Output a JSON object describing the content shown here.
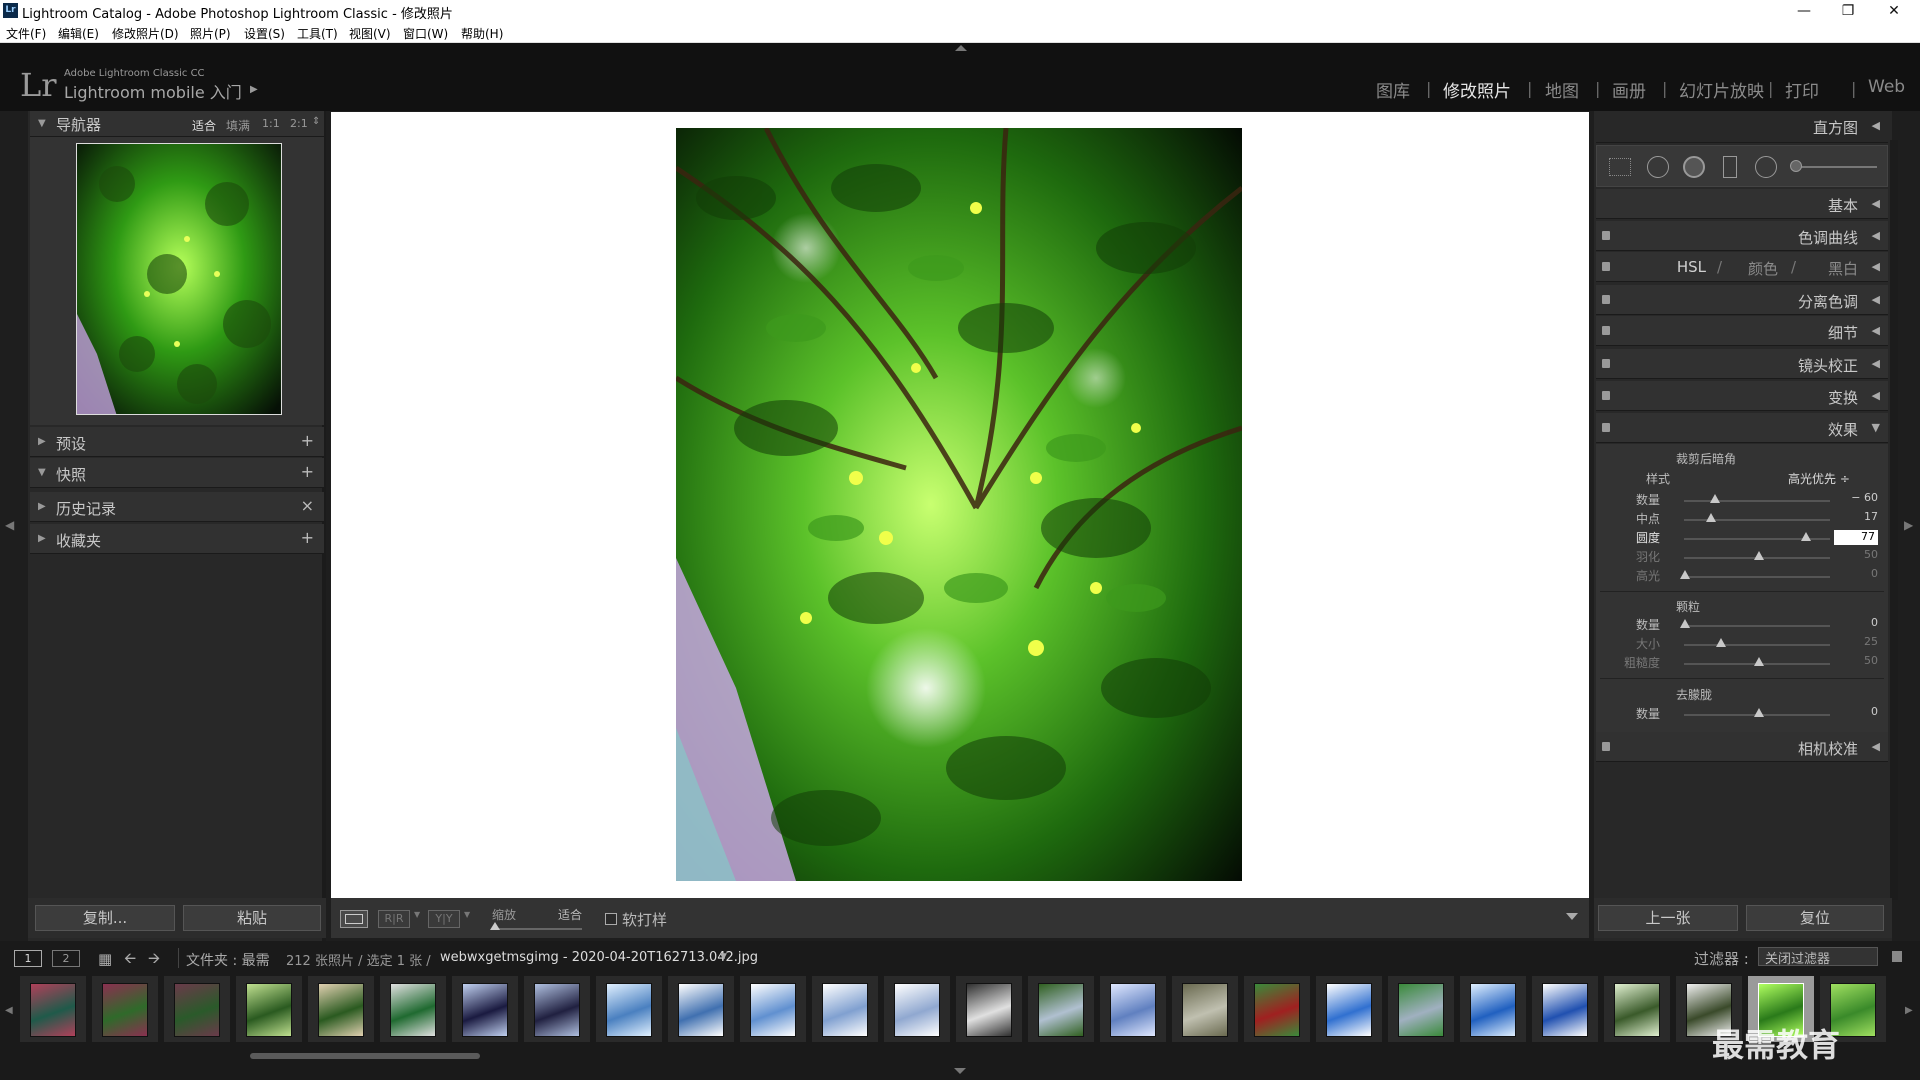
{
  "window": {
    "title": "Lightroom Catalog - Adobe Photoshop Lightroom Classic - 修改照片",
    "app_icon": "Lr"
  },
  "menu": [
    "文件(F)",
    "编辑(E)",
    "修改照片(D)",
    "照片(P)",
    "设置(S)",
    "工具(T)",
    "视图(V)",
    "窗口(W)",
    "帮助(H)"
  ],
  "identity": {
    "logo": "Lr",
    "line1": "Adobe Lightroom Classic CC",
    "line2": "Lightroom mobile 入门"
  },
  "modules": [
    "图库",
    "修改照片",
    "地图",
    "画册",
    "幻灯片放映",
    "打印",
    "Web"
  ],
  "active_module": "修改照片",
  "left_panel": {
    "navigator": {
      "label": "导航器",
      "zoom": [
        "适合",
        "填满",
        "1:1",
        "2:1"
      ]
    },
    "sections": [
      {
        "label": "预设",
        "action": "+"
      },
      {
        "label": "快照",
        "action": "+"
      },
      {
        "label": "历史记录",
        "action": "×"
      },
      {
        "label": "收藏夹",
        "action": "+"
      }
    ],
    "copy_label": "复制...",
    "paste_label": "粘贴"
  },
  "toolbar": {
    "zoom_label": "缩放",
    "fit_label": "适合",
    "softproof_label": "软打样"
  },
  "right_panel": {
    "histogram": "直方图",
    "basic": "基本",
    "tone_curve": "色调曲线",
    "hsl": [
      "HSL",
      "颜色",
      "黑白"
    ],
    "split_toning": "分离色调",
    "detail": "细节",
    "lens": "镜头校正",
    "transform": "变换",
    "effects": "效果",
    "vignette": {
      "title": "裁剪后暗角",
      "style_label": "样式",
      "style_value": "高光优先 ÷",
      "sliders": [
        {
          "name": "数量",
          "value": "− 60",
          "pos": 0.2
        },
        {
          "name": "中点",
          "value": "17",
          "pos": 0.17
        },
        {
          "name": "圆度",
          "value": "77",
          "pos": 0.85,
          "editing": true
        },
        {
          "name": "羽化",
          "value": "50",
          "pos": 0.5,
          "dim": true
        },
        {
          "name": "高光",
          "value": "0",
          "pos": 0.0,
          "dim": true
        }
      ]
    },
    "grain": {
      "title": "颗粒",
      "sliders": [
        {
          "name": "数量",
          "value": "0",
          "pos": 0.0
        },
        {
          "name": "大小",
          "value": "25",
          "pos": 0.25,
          "dim": true
        },
        {
          "name": "粗糙度",
          "value": "50",
          "pos": 0.5,
          "dim": true
        }
      ]
    },
    "dehaze": {
      "title": "去朦胧",
      "sliders": [
        {
          "name": "数量",
          "value": "0",
          "pos": 0.5
        }
      ]
    },
    "camera": "相机校准",
    "prev_label": "上一张",
    "reset_label": "复位"
  },
  "filmstrip_bar": {
    "screen1": "1",
    "screen2": "2",
    "source": "文件夹 : 最需",
    "count": "212 张照片 / 选定 1 张 /",
    "filename": "webwxgetmsgimg - 2020-04-20T162713.042.jpg",
    "filter_label": "过滤器 :",
    "filter_value": "关闭过滤器"
  },
  "watermark": "最需教育",
  "colors": {
    "accent": "#e6e6e6",
    "panel": "#282828",
    "canvas": "#ffffff"
  }
}
